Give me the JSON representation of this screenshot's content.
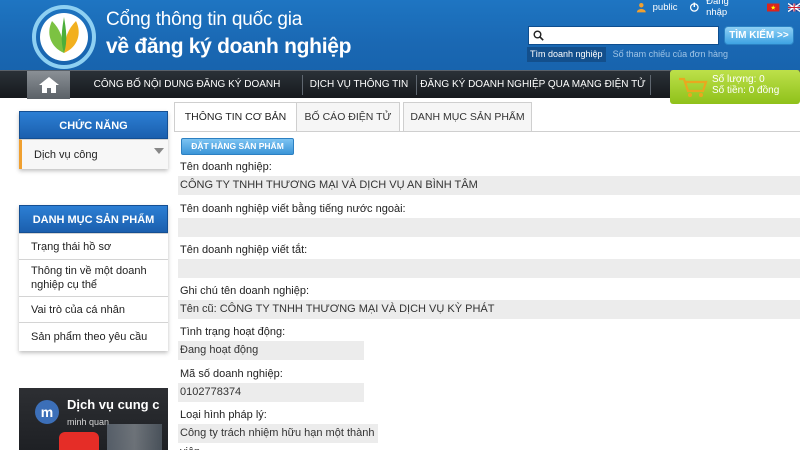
{
  "header": {
    "title_line1": "Cổng thông tin quốc gia",
    "title_line2": "về đăng ký doanh nghiệp",
    "public_label": "public",
    "login_label": "Đăng nhập",
    "search": {
      "value": "",
      "placeholder": "",
      "button_label": "TÌM KIẾM >>",
      "tab_active": "Tìm doanh nghiệp",
      "tab_inactive": "Số tham chiếu của đơn hàng"
    }
  },
  "nav": {
    "items": [
      "CÔNG BỐ NỘI DUNG ĐĂNG KÝ DOANH NGHIỆP",
      "DỊCH VỤ THÔNG TIN",
      "ĐĂNG KÝ DOANH NGHIỆP QUA MẠNG ĐIỆN TỬ"
    ]
  },
  "cart": {
    "quantity": "Số lượng: 0",
    "amount": "Số tiền: 0 đồng"
  },
  "sidebar": {
    "function_title": "CHỨC NĂNG",
    "function_item": "Dịch vụ công",
    "catalog_title": "DANH MỤC SẢN PHẨM",
    "catalog_items": [
      "Trạng thái hồ sơ",
      "Thông tin về một doanh nghiệp cụ thể",
      "Vai trò của cá nhân",
      "Sản phẩm theo yêu cầu"
    ],
    "video": {
      "channel_initial": "m",
      "title": "Dịch vụ cung c",
      "channel": "minh quan"
    }
  },
  "tabs": [
    "THÔNG TIN CƠ BẢN",
    "BỐ CÁO ĐIỆN TỬ",
    "DANH MỤC SẢN PHẨM"
  ],
  "order_button": "ĐẶT HÀNG SẢN PHẨM",
  "fields": [
    {
      "label": "Tên doanh nghiệp:",
      "value": "CÔNG TY TNHH THƯƠNG MẠI VÀ DỊCH VỤ AN BÌNH TÂM"
    },
    {
      "label": "Tên doanh nghiệp viết bằng tiếng nước ngoài:",
      "value": ""
    },
    {
      "label": "Tên doanh nghiệp viết tắt:",
      "value": ""
    },
    {
      "label": "Ghi chú tên doanh nghiệp:",
      "value": "Tên cũ: CÔNG TY TNHH THƯƠNG MẠI VÀ DỊCH VỤ KỲ PHÁT"
    },
    {
      "label": "Tình trạng hoạt động:",
      "value": "Đang hoạt động"
    },
    {
      "label": "Mã số doanh nghiệp:",
      "value": "0102778374"
    },
    {
      "label": "Loại hình pháp lý:",
      "value": "Công ty trách nhiệm hữu hạn một thành viên"
    }
  ],
  "colors": {
    "header_blue": "#1a68b3",
    "nav_dark": "#1c2024",
    "cart_green": "#9bc927",
    "sidebar_head_blue": "#1f6bbb",
    "field_bg": "#ececec"
  }
}
